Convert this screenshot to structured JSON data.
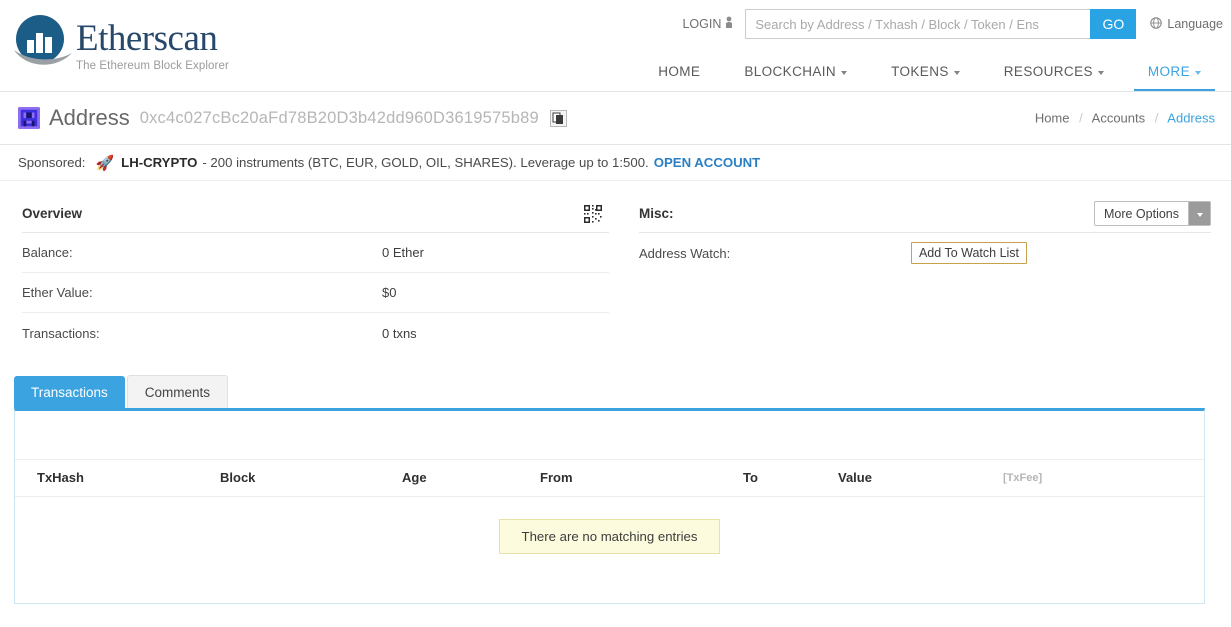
{
  "brand": {
    "name": "Etherscan",
    "tagline": "The Ethereum Block Explorer"
  },
  "header": {
    "login_label": "LOGIN",
    "login_icon": "user-icon",
    "search_placeholder": "Search by Address / Txhash / Block / Token / Ens",
    "search_value": "",
    "go_label": "GO",
    "language_label": "Language",
    "language_icon": "globe-icon",
    "accent_color": "#29a3e3",
    "nav": [
      {
        "label": "HOME",
        "has_caret": false,
        "active": false
      },
      {
        "label": "BLOCKCHAIN",
        "has_caret": true,
        "active": false
      },
      {
        "label": "TOKENS",
        "has_caret": true,
        "active": false
      },
      {
        "label": "RESOURCES",
        "has_caret": true,
        "active": false
      },
      {
        "label": "MORE",
        "has_caret": true,
        "active": true
      }
    ]
  },
  "address_bar": {
    "title": "Address",
    "hash": "0xc4c027cBc20aFd78B20D3b42dd960D3619575b89",
    "identicon": "blockie-identicon",
    "copy_icon": "copy-icon",
    "breadcrumb": {
      "home": "Home",
      "accounts": "Accounts",
      "current": "Address",
      "separator": "/"
    }
  },
  "sponsored": {
    "lead": "Sponsored:",
    "icon": "rocket-icon",
    "advertiser": "LH-CRYPTO",
    "text": "- 200 instruments (BTC, EUR, GOLD, OIL, SHARES). Leverage up to 1:500.",
    "cta": "OPEN ACCOUNT"
  },
  "overview": {
    "title": "Overview",
    "qr_icon": "qr-code-icon",
    "rows": [
      {
        "key": "Balance:",
        "value": "0 Ether"
      },
      {
        "key": "Ether Value:",
        "value": "$0"
      },
      {
        "key": "Transactions:",
        "value": "0 txns"
      }
    ]
  },
  "misc": {
    "title": "Misc:",
    "more_options_label": "More Options",
    "more_options_icon": "chevron-down-icon",
    "rows": [
      {
        "key": "Address Watch:",
        "button": "Add To Watch List"
      }
    ]
  },
  "tabs": [
    {
      "label": "Transactions",
      "active": true
    },
    {
      "label": "Comments",
      "active": false
    }
  ],
  "transactions_table": {
    "columns": [
      "TxHash",
      "Block",
      "Age",
      "From",
      "To",
      "Value",
      "[TxFee]"
    ],
    "rows": [],
    "empty_message": "There are no matching entries"
  }
}
